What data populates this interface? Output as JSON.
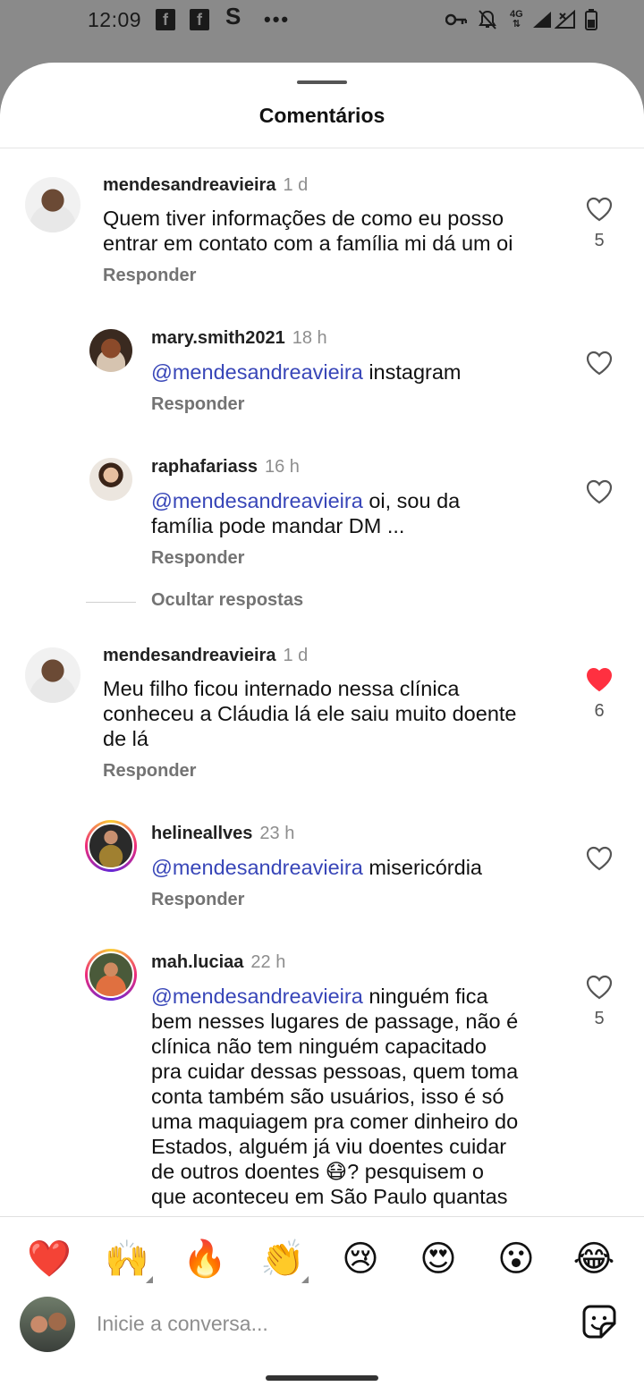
{
  "status_bar": {
    "time": "12:09",
    "notif_1": "f",
    "notif_2": "f",
    "notif_3": "S",
    "more": "•••",
    "network": "4G"
  },
  "sheet": {
    "title": "Comentários"
  },
  "comments": [
    {
      "user": "mendesandreavieira",
      "time": "1 d",
      "mention": "",
      "text_lines": [
        "Quem tiver informações de como eu posso",
        "entrar em contato com a família mi dá um oi"
      ],
      "reply": "Responder",
      "likes": "5",
      "liked": false
    },
    {
      "user": "mary.smith2021",
      "time": "18 h",
      "mention": "@mendesandreavieira",
      "text_lines": [
        " instagram"
      ],
      "reply": "Responder",
      "likes": "",
      "liked": false
    },
    {
      "user": "raphafariass",
      "time": "16 h",
      "mention": "@mendesandreavieira",
      "text_lines": [
        " oi, sou da",
        "família pode mandar DM ..."
      ],
      "reply": "Responder",
      "likes": "",
      "liked": false
    },
    {
      "user": "mendesandreavieira",
      "time": "1 d",
      "mention": "",
      "text_lines": [
        "Meu filho ficou internado nessa clínica",
        "conheceu a Cláudia lá ele saiu muito doente",
        "de lá"
      ],
      "reply": "Responder",
      "likes": "6",
      "liked": true
    },
    {
      "user": "helineallves",
      "time": "23 h",
      "mention": "@mendesandreavieira",
      "text_lines": [
        " misericórdia"
      ],
      "reply": "Responder",
      "likes": "",
      "liked": false
    },
    {
      "user": "mah.luciaa",
      "time": "22 h",
      "mention": "@mendesandreavieira",
      "text_lines": [
        " ninguém fica",
        "bem nesses lugares de passage, não é",
        "clínica não tem ninguém capacitado",
        "pra cuidar dessas pessoas, quem toma",
        "conta também são usuários, isso é só",
        "uma maquiagem pra comer dinheiro do",
        "Estados, alguém já viu doentes cuidar",
        "de outros doentes 😷? pesquisem o",
        "que aconteceu em São Paulo quantas"
      ],
      "reply": "",
      "likes": "5",
      "liked": false
    }
  ],
  "hide_replies": "Ocultar respostas",
  "emoji_bar": [
    "❤️",
    "🙌",
    "🔥",
    "👏",
    "😢",
    "😍",
    "😮",
    "😂"
  ],
  "composer": {
    "placeholder": "Inicie a conversa..."
  },
  "colors": {
    "mention": "#3846b8",
    "like_active": "#ff3040"
  }
}
